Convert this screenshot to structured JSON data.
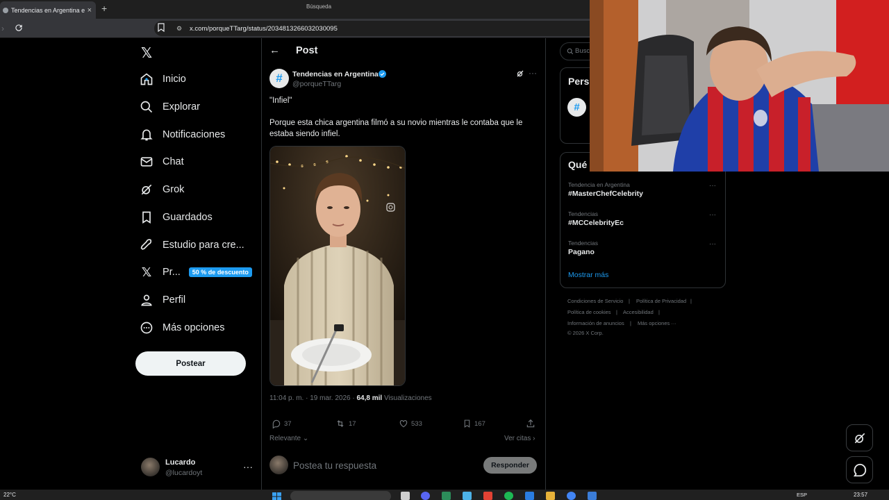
{
  "browser": {
    "tab_title": "Tendencias en Argentina en X",
    "tab_close": "×",
    "new_tab": "+",
    "url": "x.com/porqueTTarg/status/2034813266032030095"
  },
  "sidebar": {
    "items": [
      {
        "label": "Inicio",
        "icon": "home-icon"
      },
      {
        "label": "Explorar",
        "icon": "search-icon"
      },
      {
        "label": "Notificaciones",
        "icon": "bell-icon"
      },
      {
        "label": "Chat",
        "icon": "mail-icon"
      },
      {
        "label": "Grok",
        "icon": "grok-icon"
      },
      {
        "label": "Guardados",
        "icon": "bookmark-icon"
      },
      {
        "label": "Estudio para cre...",
        "icon": "rocket-icon"
      },
      {
        "label": "Pr...",
        "icon": "x-premium-icon",
        "badge": "50 % de descuento"
      },
      {
        "label": "Perfil",
        "icon": "user-icon"
      },
      {
        "label": "Más opciones",
        "icon": "more-circle-icon"
      }
    ],
    "post_button": "Postear",
    "account": {
      "name": "Lucardo",
      "handle": "@lucardoyt",
      "more": "···"
    }
  },
  "header": {
    "title": "Post",
    "back": "←"
  },
  "post": {
    "author_name": "Tendencias en Argentina",
    "author_handle": "@porqueTTarg",
    "avatar_glyph": "#",
    "more": "···",
    "text_line1": "\"Infiel\"",
    "text_body": "Porque esta chica argentina filmó a su novio mientras le contaba que le estaba siendo infiel.",
    "time": "11:04 p. m.",
    "date": "19 mar. 2026",
    "views_count": "64,8 mil",
    "views_label": "Visualizaciones",
    "stats": {
      "replies": "37",
      "reposts": "17",
      "likes": "533",
      "bookmarks": "167"
    },
    "sort_label": "Relevante",
    "quotes_label": "Ver citas"
  },
  "reply": {
    "placeholder": "Postea tu respuesta",
    "button": "Responder"
  },
  "right": {
    "search_placeholder": "Busc",
    "box1_title": "Pers",
    "box1_avatar_glyph": "#",
    "trends_title": "Qué",
    "trends": [
      {
        "category": "Tendencia en Argentina",
        "name": "#MasterChefCelebrity"
      },
      {
        "category": "Tendencias",
        "name": "#MCCelebrityEc"
      },
      {
        "category": "Tendencias",
        "name": "Pagano"
      }
    ],
    "trend_more": "···",
    "show_more": "Mostrar más",
    "footer": {
      "terms": "Condiciones de Servicio",
      "privacy": "Política de Privacidad",
      "cookies": "Política de cookies",
      "accessibility": "Accesibilidad",
      "ads": "Información de anuncios",
      "more": "Más opciones ···",
      "copyright": "© 2026 X Corp.",
      "sep": "|"
    }
  },
  "taskbar": {
    "weather": "22°C",
    "search_placeholder": "Búsqueda",
    "lang": "ESP",
    "time": "23:57"
  },
  "colors": {
    "accent": "#1d9bf0",
    "background": "#000000",
    "border": "#2f3336",
    "muted": "#71767b"
  }
}
